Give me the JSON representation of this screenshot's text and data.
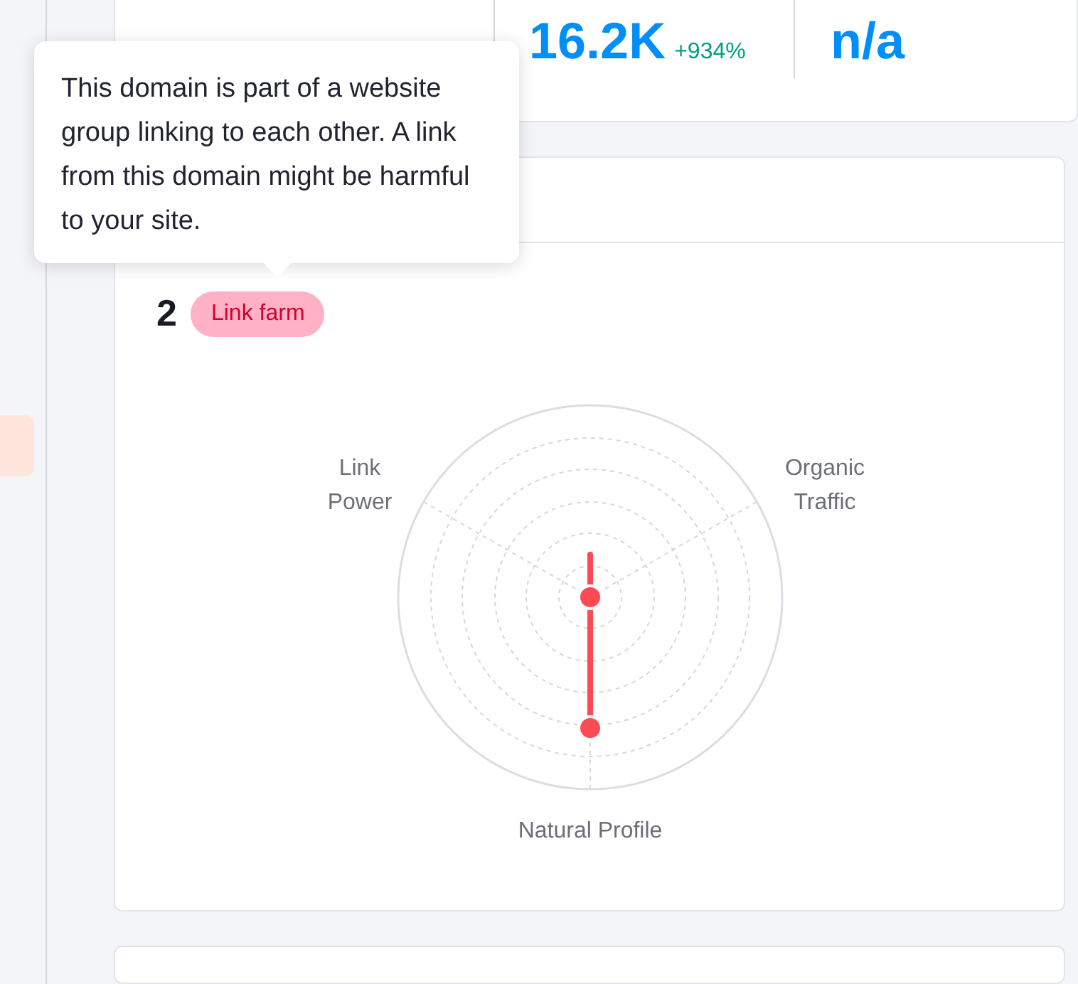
{
  "metrics": [
    {
      "value": "16.2K",
      "change": "+934%"
    },
    {
      "value": "n/a"
    }
  ],
  "tooltip": {
    "text": "This domain is part of a website group linking to each other. A link from this domain might be harmful to your site."
  },
  "network_card": {
    "count": "2",
    "badge": "Link farm",
    "axes": [
      "Link Power",
      "Organic Traffic",
      "Natural Profile"
    ]
  }
}
